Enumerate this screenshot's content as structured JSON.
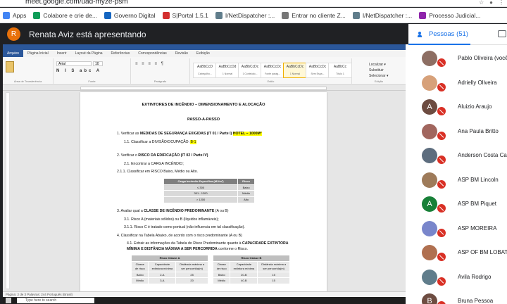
{
  "browser": {
    "url": "meet.google.com/uad-myze-psm",
    "bookmarks": [
      {
        "label": "Apps",
        "color": "#4285f4"
      },
      {
        "label": "Colabore e crie de...",
        "color": "#0f9d58"
      },
      {
        "label": "Governo Digital",
        "color": "#1565c0"
      },
      {
        "label": "S|Portal 1.5.1",
        "color": "#d32f2f"
      },
      {
        "label": "I/NetDispatcher :...",
        "color": "#607d8b"
      },
      {
        "label": "Entrar no cliente Z...",
        "color": "#777777"
      },
      {
        "label": "I/NetDispatcher :...",
        "color": "#607d8b"
      },
      {
        "label": "Processo Judicial...",
        "color": "#8e24aa"
      }
    ]
  },
  "meet": {
    "presenter_initial": "R",
    "presenter_text": "Renata Aviz está apresentando"
  },
  "word": {
    "tabs": [
      "Arquivo",
      "Página Inicial",
      "Inserir",
      "Layout da Página",
      "Referências",
      "Correspondências",
      "Revisão",
      "Exibição"
    ],
    "groups": [
      "Área de Transferência",
      "Fonte",
      "Parágrafo",
      "Estilo",
      "Edição"
    ],
    "font_name": "Arial",
    "font_size": "10",
    "styles": [
      {
        "preview": "AaBbCcD",
        "name": "Cabeçalho..."
      },
      {
        "preview": "AaBbCcDd",
        "name": "1 Normal"
      },
      {
        "preview": "AaBbCcDc",
        "name": "1 Conteúdo..."
      },
      {
        "preview": "AaBbCcDc",
        "name": "Fonte parág..."
      },
      {
        "preview": "AaBbCcDc",
        "name": "1 Normal"
      },
      {
        "preview": "AaBbCcDc",
        "name": "Sem Espa..."
      },
      {
        "preview": "AaBbCc",
        "name": "Título 1"
      }
    ],
    "doc": {
      "title": "EXTINTORES DE INCÊNDIO – DIMENSIONAMENTO E ALOCAÇÃO",
      "subtitle": "PASSO-A-PASSO",
      "item1_prefix": "1. Verificar as ",
      "item1_bold": "MEDIDAS DE SEGURANÇA EXIGIDAS (IT 01 / Parte I)",
      "item1_hl": "HOTEL – 1000M²",
      "item11_prefix": "1.1. Classificar a ",
      "item11_mid": "DIVISÃO/OCUPAÇÃO:",
      "item11_hl": "B-1",
      "item2_prefix": "2. Verificar o ",
      "item2_bold": "RISCO DA EDIFICAÇÃO",
      "item2_suffix": " (IT 02 / Parte IV)",
      "item21": "2.1. Encontrar a CARGA INCÊNDIO;",
      "item211": "2.1.1. Classificar em RISCO  Baixo, Médio ou Alto.",
      "risk_table": {
        "headers": [
          "Carga Incêndio Específica (MJ/m²)",
          "Risco"
        ],
        "rows": [
          [
            "≤ 300",
            "Baixo"
          ],
          [
            "301 - 1200",
            "Médio"
          ],
          [
            "> 1200",
            "Alto"
          ]
        ]
      },
      "item3_prefix": "3. Avaliar qual a ",
      "item3_bold": "CLASSE DE INCÊNDIO PREDOMINANTE",
      "item3_suffix": " (A ou B)",
      "item31": "3.1. Risco A (materiais sólidos) ou B (líquidos inflamáveis);",
      "item311": "3.1.1. Risco C é tratado como pontual (não influencia em tal classificação).",
      "item4": "4. Classificar na Tabela Abaixo, de acordo com o risco predominante (A ou B)",
      "item41_prefix": "4.1. Extrair as informações da Tabela do Risco Predominante quanto à ",
      "item41_bold": "CAPACIDADE EXTINTORA MÍNIMA E DISTÂNCIA MÁXIMA A SER PERCORRIDA",
      "item41_suffix": " conforme o Risco.",
      "classA": {
        "title": "Risco Classe A",
        "headers": [
          "Classe de risco",
          "Capacidade extintora mínima",
          "Distância máxima a ser percorrida(m)"
        ],
        "rows": [
          [
            "Baixo",
            "2-A",
            "25"
          ],
          [
            "Médio",
            "3-A",
            "20"
          ]
        ]
      },
      "classB": {
        "title": "Risco Classe B",
        "headers": [
          "Classe de risco",
          "Capacidade extintora mínima",
          "Distância máxima a ser percorrida(m)"
        ],
        "rows": [
          [
            "Baixo",
            "20-B",
            "15"
          ],
          [
            "Médio",
            "40-B",
            "15"
          ]
        ]
      }
    },
    "status": "Página: 2 de 3   Palavras: 244   Português (Brasil)",
    "taskbar_search": "Type here to search"
  },
  "people": {
    "tab_label": "Pessoas (51)",
    "list": [
      {
        "name": "Pablo Oliveira (você)",
        "initial": "",
        "color": "#8d6e63"
      },
      {
        "name": "Adrielly Oliveira",
        "initial": "",
        "color": "#d7a17a"
      },
      {
        "name": "Aluizio Araujo",
        "initial": "A",
        "color": "#6d4c41"
      },
      {
        "name": "Ana Paula Britto",
        "initial": "",
        "color": "#a1665e"
      },
      {
        "name": "Anderson Costa Can...",
        "initial": "",
        "color": "#5d6d7e"
      },
      {
        "name": "ASP BM Lincoln",
        "initial": "",
        "color": "#9e7b5a"
      },
      {
        "name": "ASP BM Piquet",
        "initial": "A",
        "color": "#188038"
      },
      {
        "name": "ASP MOREIRA",
        "initial": "",
        "color": "#7986cb"
      },
      {
        "name": "ASP OF BM LOBATO",
        "initial": "",
        "color": "#b07050"
      },
      {
        "name": "Avila Rodrigo",
        "initial": "",
        "color": "#607d8b"
      },
      {
        "name": "Bruna Pessoa",
        "initial": "B",
        "color": "#6d4c41"
      }
    ]
  }
}
